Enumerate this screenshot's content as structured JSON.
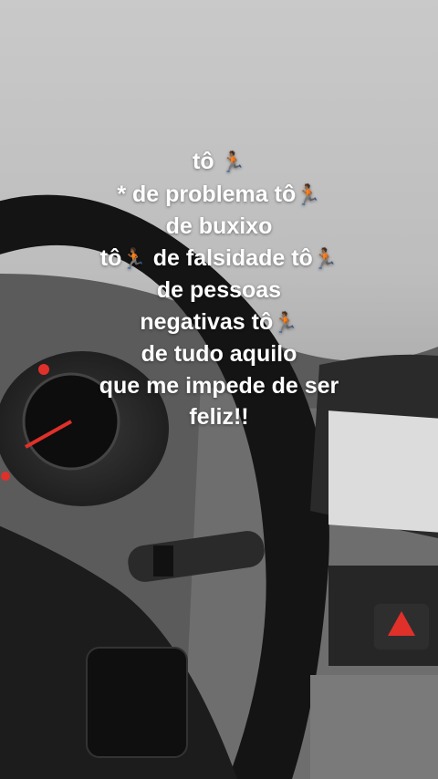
{
  "story": {
    "caption_lines": [
      {
        "text": "tô",
        "emoji": "🏃🏾"
      },
      {
        "text": "* de problema tô",
        "emoji": "🏃🏾"
      },
      {
        "text": "de buxixo",
        "emoji": ""
      },
      {
        "text": "tô",
        "emoji": "🏃🏾",
        "after": " de falsidade tô",
        "emoji2": "🏃🏾"
      },
      {
        "text": "de pessoas",
        "emoji": ""
      },
      {
        "text": "negativas tô",
        "emoji": "🏃🏾"
      },
      {
        "text": "de tudo aquilo",
        "emoji": ""
      },
      {
        "text": "que me impede de ser",
        "emoji": ""
      },
      {
        "text": "feliz!!",
        "emoji": ""
      }
    ],
    "emoji_name": "person-running-icon"
  }
}
